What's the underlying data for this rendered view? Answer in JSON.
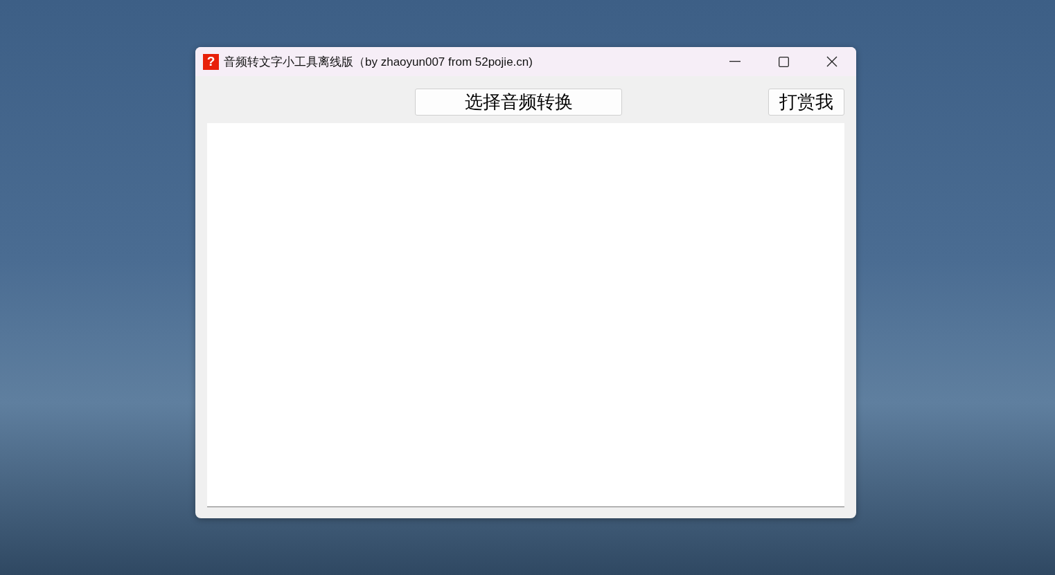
{
  "window": {
    "icon_glyph": "?",
    "title": "音频转文字小工具离线版（by zhaoyun007 from 52pojie.cn)"
  },
  "buttons": [
    {
      "kind": "main",
      "label": "选择音频转换"
    },
    {
      "kind": "side",
      "label": "打赏我"
    }
  ]
}
